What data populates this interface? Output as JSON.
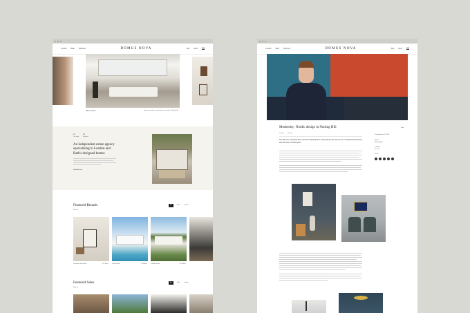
{
  "brand": "DOMUS NOVA",
  "left": {
    "nav": {
      "links": [
        "London",
        "Bath",
        "Discover"
      ],
      "right": [
        "Buy",
        "Rent"
      ]
    },
    "hero": {
      "caption_left": "Villiers House",
      "caption_right": "A private residence overlooking the garden in Notting Hill"
    },
    "intro": {
      "tags": [
        "01",
        "02"
      ],
      "sub": [
        "Our story",
        "Services"
      ],
      "heading": "An independent estate agency specialising in London and Bath's designed homes",
      "cta": "Read the story"
    },
    "rentals": {
      "title": "Featured Rentals",
      "filter_label": "Filter by",
      "tabs": [
        "All",
        "Bath",
        "London"
      ],
      "cards": [
        {
          "name": "Lancaster Gate Road",
          "price": "£1,750pw"
        },
        {
          "name": "Castle Road",
          "price": "£2,300pw"
        },
        {
          "name": "Colville Terrace",
          "price": "£3,500pw"
        }
      ]
    },
    "sales": {
      "title": "Featured Sales",
      "filter_label": "Filter by",
      "tabs": [
        "All",
        "Bath",
        "London"
      ]
    }
  },
  "right": {
    "nav": {
      "links": [
        "London",
        "Bath",
        "Discover"
      ],
      "right": [
        "Buy",
        "Rent"
      ]
    },
    "article": {
      "title": "Modernity: Nordic design in Notting Hill",
      "meta": [
        "Journal",
        "Interiors"
      ],
      "lead": "UK Director, Sebastian Holt, discusses Modernity's London showroom, his love for Scandinavian furniture and his most-coveted pieces",
      "back": "Back",
      "sidebar": {
        "date": "Posted August 22, 2019",
        "author_label": "Author",
        "author": "Domus Nova",
        "category_label": "Category",
        "category": "Interiors",
        "share_label": "Share"
      }
    }
  },
  "colors": {
    "background": "#d9d9d4",
    "accent": "#b04a33",
    "cream": "#f5f3ee"
  }
}
